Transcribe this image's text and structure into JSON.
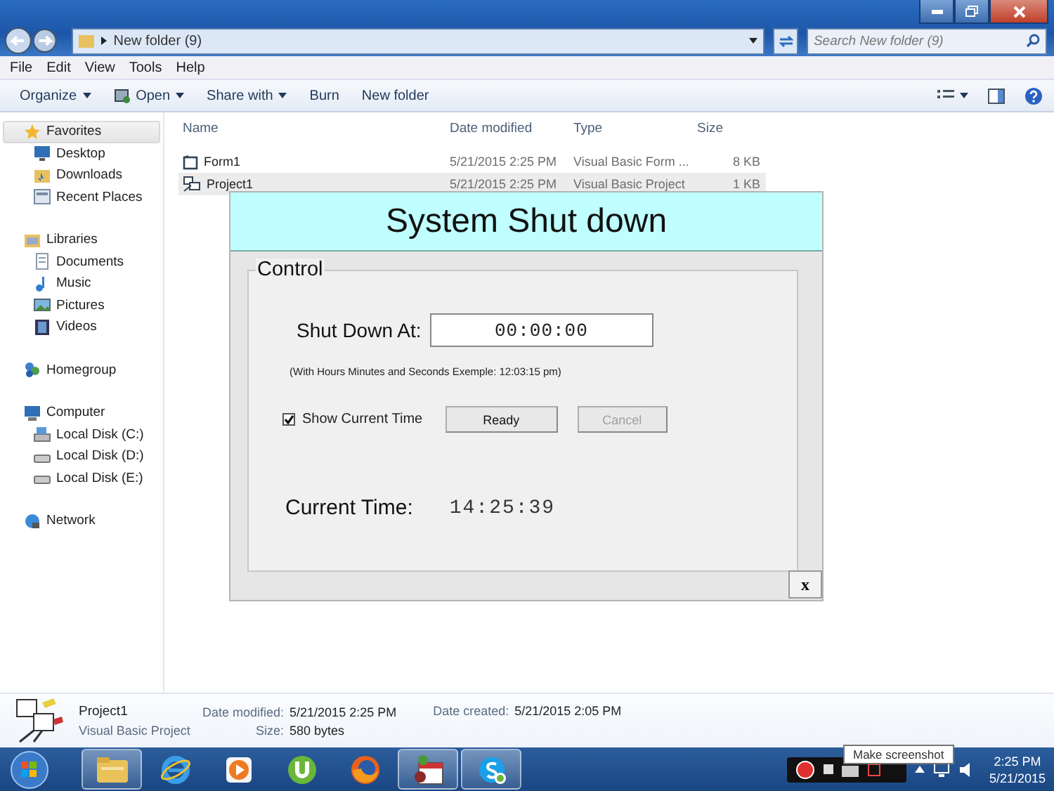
{
  "window": {
    "address": "New folder (9)",
    "search_placeholder": "Search New folder (9)"
  },
  "menu": [
    "File",
    "Edit",
    "View",
    "Tools",
    "Help"
  ],
  "toolbar": [
    {
      "label": "Organize",
      "dropdown": true
    },
    {
      "label": "Open",
      "dropdown": true
    },
    {
      "label": "Share with",
      "dropdown": true
    },
    {
      "label": "Burn",
      "dropdown": false
    },
    {
      "label": "New folder",
      "dropdown": false
    }
  ],
  "sidebar": [
    {
      "label": "Favorites",
      "selected": true,
      "children": [
        {
          "label": "Desktop",
          "selected": false
        },
        {
          "label": "Downloads",
          "selected": false
        },
        {
          "label": "Recent Places",
          "selected": false
        }
      ]
    },
    {
      "label": "Libraries",
      "selected": false,
      "children": [
        {
          "label": "Documents",
          "selected": false
        },
        {
          "label": "Music",
          "selected": false
        },
        {
          "label": "Pictures",
          "selected": false
        },
        {
          "label": "Videos",
          "selected": false
        }
      ]
    },
    {
      "label": "Homegroup",
      "selected": false
    },
    {
      "label": "Computer",
      "selected": false,
      "children": [
        {
          "label": "Local Disk (C:)",
          "selected": false
        },
        {
          "label": "Local Disk (D:)",
          "selected": false
        },
        {
          "label": "Local Disk (E:)",
          "selected": false
        }
      ]
    },
    {
      "label": "Network",
      "selected": false
    }
  ],
  "files": {
    "columns": [
      "Name",
      "Date modified",
      "Type",
      "Size"
    ],
    "rows": [
      {
        "name": "Form1",
        "date": "5/21/2015 2:25 PM",
        "type": "Visual Basic Form ...",
        "size": "8 KB",
        "selected": false
      },
      {
        "name": "Project1",
        "date": "5/21/2015 2:25 PM",
        "type": "Visual Basic Project",
        "size": "1 KB",
        "selected": true
      }
    ]
  },
  "details": {
    "name": "Project1",
    "type": "Visual Basic Project",
    "modified_label": "Date modified:",
    "modified": "5/21/2015 2:25 PM",
    "size_label": "Size:",
    "size": "580 bytes",
    "created_label": "Date created:",
    "created": "5/21/2015 2:05 PM"
  },
  "form": {
    "title": "System Shut down",
    "group": "Control",
    "shutdown_label": "Shut Down At:",
    "shutdown_value": "00:00:00",
    "hint": "(With Hours Minutes and Seconds Exemple: 12:03:15 pm)",
    "checkbox": {
      "label": "Show Current Time",
      "checked": true
    },
    "buttons": [
      {
        "label": "Ready",
        "disabled": false
      },
      {
        "label": "Cancel",
        "disabled": true
      }
    ],
    "current_label": "Current Time:",
    "current_value": "14:25:39",
    "close": "x"
  },
  "taskbar": {
    "apps": [
      {
        "kind": "folder",
        "active": true
      },
      {
        "kind": "browser",
        "active": false
      },
      {
        "kind": "media",
        "active": false
      },
      {
        "kind": "torrent",
        "active": false
      },
      {
        "kind": "firefox",
        "active": false
      },
      {
        "kind": "vb",
        "active": true
      },
      {
        "kind": "chat",
        "active": true
      }
    ],
    "tooltip": "Make screenshot",
    "time": "2:25 PM",
    "date": "5/21/2015"
  }
}
